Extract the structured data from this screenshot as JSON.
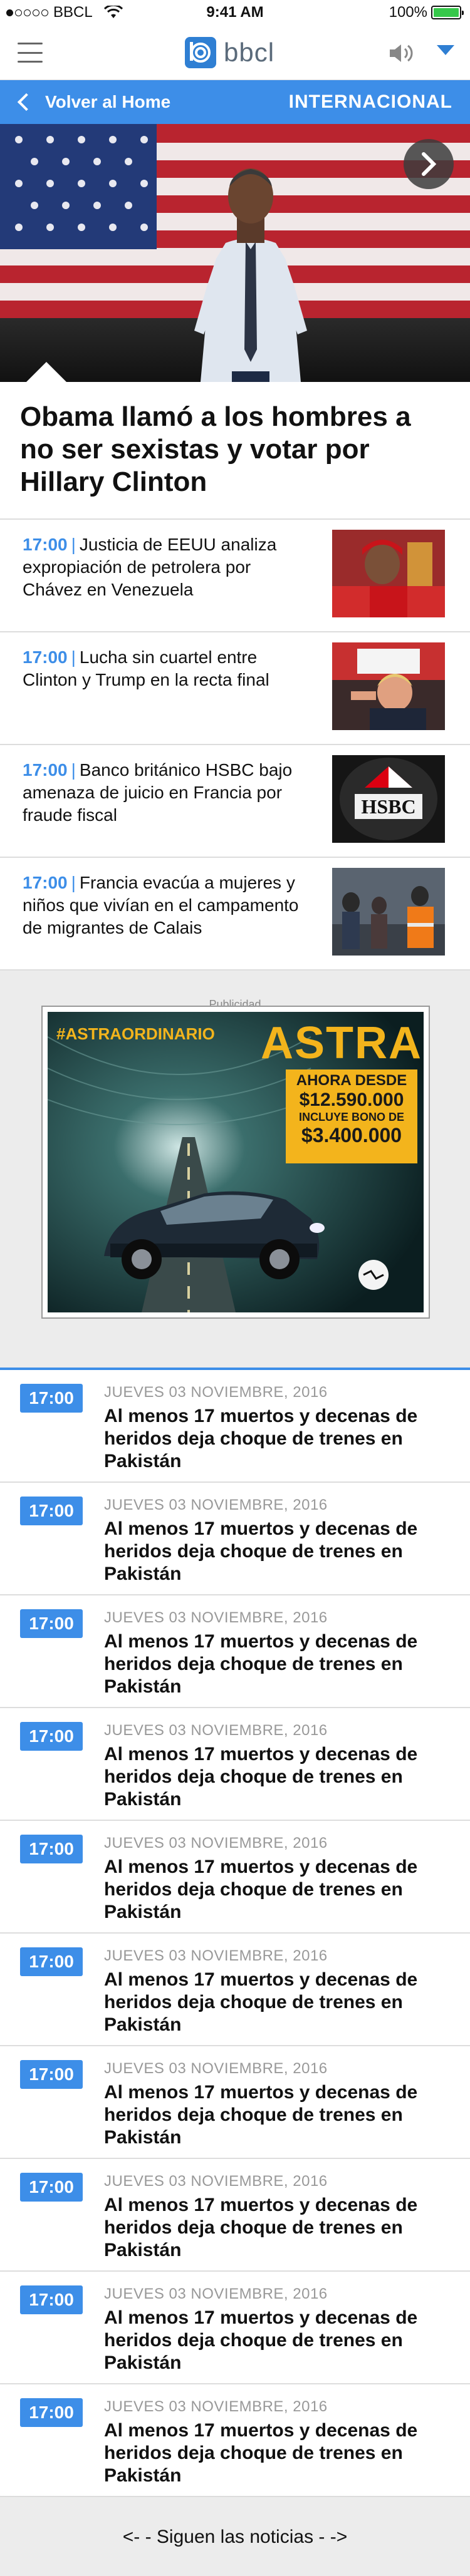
{
  "status_bar": {
    "carrier": "BBCL",
    "time": "9:41 AM",
    "battery_text": "100%"
  },
  "header": {
    "logo_text": "bbcl",
    "menu_icon": "hamburger-icon",
    "speaker_icon": "speaker-icon",
    "dropdown_icon": "caret-down-icon"
  },
  "section_bar": {
    "back_label": "Volver al Home",
    "section_name": "INTERNACIONAL"
  },
  "hero": {
    "title": "Obama llamó a los hombres a no ser sexistas y votar por Hillary Clinton",
    "next_icon": "chevron-right-icon"
  },
  "news": [
    {
      "time": "17:00",
      "separator": "|",
      "title": "Justicia de EEUU analiza expropiación de petrolera por Chávez en Venezuela"
    },
    {
      "time": "17:00",
      "separator": "|",
      "title": "Lucha sin cuartel entre Clinton y Trump en la recta final"
    },
    {
      "time": "17:00",
      "separator": "|",
      "title": "Banco británico HSBC bajo amenaza de juicio en Francia por fraude fiscal"
    },
    {
      "time": "17:00",
      "separator": "|",
      "title": "Francia evacúa a mujeres y niños que vivían en el campamento de migrantes de Calais"
    }
  ],
  "ad": {
    "label": "Publicidad",
    "hashtag": "#ASTRAORDINARIO",
    "brand": "ASTRA",
    "line1": "AHORA DESDE",
    "price": "$12.590.000",
    "line3": "INCLUYE BONO DE",
    "bonus": "$3.400.000"
  },
  "timeline": [
    {
      "time": "17:00",
      "date": "JUEVES 03 NOVIEMBRE, 2016",
      "title": "Al menos 17 muertos y decenas de heridos deja choque de trenes en Pakistán"
    },
    {
      "time": "17:00",
      "date": "JUEVES 03 NOVIEMBRE, 2016",
      "title": "Al menos 17 muertos y decenas de heridos deja choque de trenes en Pakistán"
    },
    {
      "time": "17:00",
      "date": "JUEVES 03 NOVIEMBRE, 2016",
      "title": "Al menos 17 muertos y decenas de heridos deja choque de trenes en Pakistán"
    },
    {
      "time": "17:00",
      "date": "JUEVES 03 NOVIEMBRE, 2016",
      "title": "Al menos 17 muertos y decenas de heridos deja choque de trenes en Pakistán"
    },
    {
      "time": "17:00",
      "date": "JUEVES 03 NOVIEMBRE, 2016",
      "title": "Al menos 17 muertos y decenas de heridos deja choque de trenes en Pakistán"
    },
    {
      "time": "17:00",
      "date": "JUEVES 03 NOVIEMBRE, 2016",
      "title": "Al menos 17 muertos y decenas de heridos deja choque de trenes en Pakistán"
    },
    {
      "time": "17:00",
      "date": "JUEVES 03 NOVIEMBRE, 2016",
      "title": "Al menos 17 muertos y decenas de heridos deja choque de trenes en Pakistán"
    },
    {
      "time": "17:00",
      "date": "JUEVES 03 NOVIEMBRE, 2016",
      "title": "Al menos 17 muertos y decenas de heridos deja choque de trenes en Pakistán"
    },
    {
      "time": "17:00",
      "date": "JUEVES 03 NOVIEMBRE, 2016",
      "title": "Al menos 17 muertos y decenas de heridos deja choque de trenes en Pakistán"
    },
    {
      "time": "17:00",
      "date": "JUEVES 03 NOVIEMBRE, 2016",
      "title": "Al menos 17 muertos y decenas de heridos deja choque de trenes en Pakistán"
    }
  ],
  "more_label": "<- - Siguen las noticias - ->",
  "colors": {
    "accent": "#3d8ee8",
    "battery": "#36c84a",
    "ad_yellow": "#f3b41c"
  }
}
